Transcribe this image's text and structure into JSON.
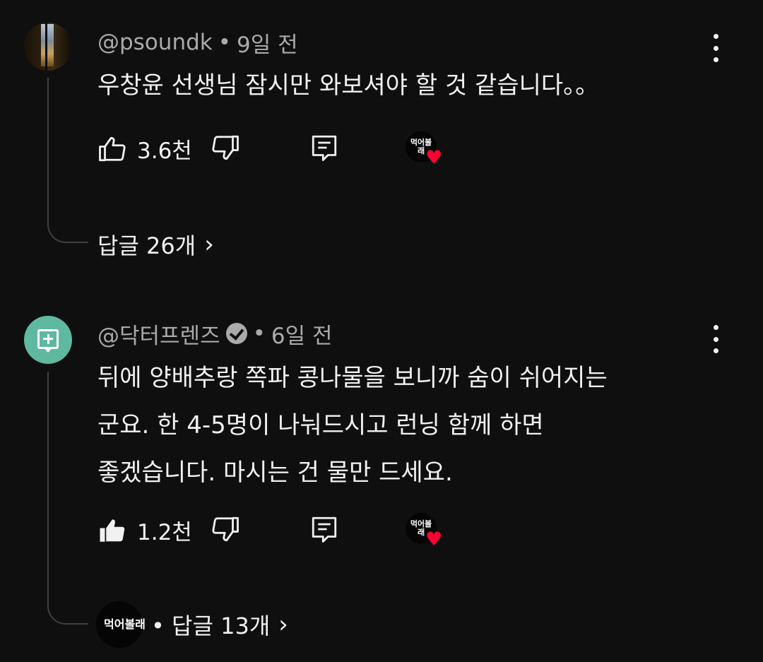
{
  "comments": [
    {
      "handle": "@psoundk",
      "separator": "•",
      "time": "9일 전",
      "text_lines": [
        "우창윤 선생님 잠시만 와보셔야 할 것 같습니다。。"
      ],
      "likes": "3.6천",
      "liked": false,
      "hearted_by": "먹어볼래",
      "replies_label": "답글 26개",
      "icons": {
        "avatar": "photo-avatar",
        "like": "thumbs-up-outline-icon",
        "dislike": "thumbs-down-icon",
        "reply": "reply-icon",
        "menu": "more-vert-icon"
      }
    },
    {
      "handle": "@닥터프렌즈",
      "verified": true,
      "separator": "•",
      "time": "6일 전",
      "text_lines": [
        "뒤에 양배추랑 쪽파 콩나물을 보니까 숨이 쉬어지는",
        "군요. 한 4-5명이 나눠드시고 런닝 함께 하면",
        "좋겠습니다. 마시는 건 물만 드세요."
      ],
      "likes": "1.2천",
      "liked": true,
      "hearted_by": "먹어볼래",
      "creator_reply_avatar": "먹어볼래",
      "replies_label": "• 답글 13개",
      "icons": {
        "avatar": "doctor-friends-logo",
        "like": "thumbs-up-filled-icon",
        "dislike": "thumbs-down-icon",
        "reply": "reply-icon",
        "menu": "more-vert-icon"
      }
    }
  ],
  "colors": {
    "background": "#0f0f0f",
    "text": "#f1f1f1",
    "meta": "#aaaaaa",
    "heart": "#ff0033",
    "avatar_mint": "#5fb8a0"
  }
}
